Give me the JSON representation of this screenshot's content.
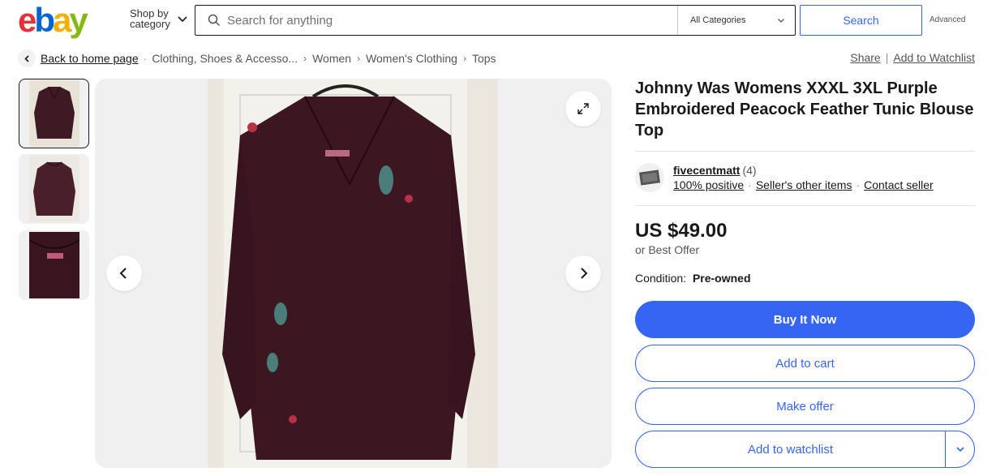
{
  "header": {
    "logo_text": "ebay",
    "shop_by_line1": "Shop by",
    "shop_by_line2": "category",
    "search_placeholder": "Search for anything",
    "category_select": "All Categories",
    "search_button": "Search",
    "advanced_link": "Advanced"
  },
  "breadcrumb": {
    "back_label": "Back to home page",
    "items": [
      "Clothing, Shoes & Accesso...",
      "Women",
      "Women's Clothing",
      "Tops"
    ]
  },
  "top_links": {
    "share": "Share",
    "watchlist": "Add to Watchlist"
  },
  "gallery": {
    "thumbnail_count": 3,
    "selected_index": 0,
    "icons": {
      "expand": "expand-icon",
      "prev": "chevron-left-icon",
      "next": "chevron-right-icon"
    }
  },
  "listing": {
    "title": "Johnny Was Womens XXXL 3XL Purple Embroidered Peacock Feather Tunic Blouse Top",
    "seller": {
      "name": "fivecentmatt",
      "feedback_count": "(4)",
      "positive": "100% positive",
      "other_items": "Seller's other items",
      "contact": "Contact seller"
    },
    "price": "US $49.00",
    "best_offer": "or Best Offer",
    "condition_label": "Condition:",
    "condition_value": "Pre-owned"
  },
  "actions": {
    "buy_now": "Buy It Now",
    "add_to_cart": "Add to cart",
    "make_offer": "Make offer",
    "add_to_watchlist": "Add to watchlist"
  },
  "colors": {
    "accent_blue": "#3665f3",
    "text_dark": "#191919",
    "text_muted": "#555555",
    "logo_red": "#e53238",
    "logo_blue": "#0064d2",
    "logo_yellow": "#f5af02",
    "logo_green": "#86b817"
  }
}
